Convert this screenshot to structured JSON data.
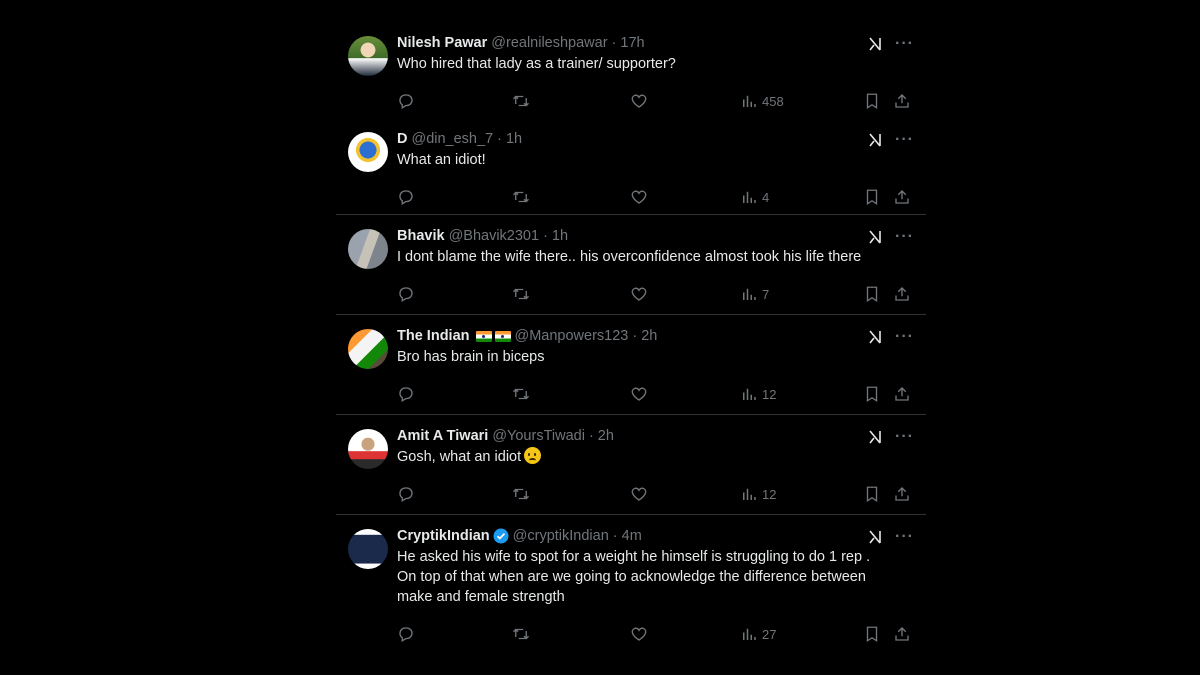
{
  "colors": {
    "background": "#000000",
    "text": "#e7e9ea",
    "muted": "#71767b",
    "divider": "#2f3336",
    "verified": "#1d9bf0"
  },
  "icons": {
    "reply": "reply-icon",
    "retweet": "retweet-icon",
    "like": "like-icon",
    "views": "views-icon",
    "bookmark": "bookmark-icon",
    "share": "share-icon",
    "grok": "grok-icon",
    "more": "more-icon"
  },
  "tweets": [
    {
      "name": "Nilesh Pawar",
      "handle": "@realnileshpawar",
      "time": "17h",
      "text": [
        "Who hired that lady as a trainer/ supporter?"
      ],
      "views": "458"
    },
    {
      "name": "D",
      "handle": "@din_esh_7",
      "time": "1h",
      "text": [
        "What an idiot!"
      ],
      "views": "4"
    },
    {
      "name": "Bhavik",
      "handle": "@Bhavik2301",
      "time": "1h",
      "text": [
        "I dont blame the wife there.. his overconfidence almost took his life there"
      ],
      "views": "7"
    },
    {
      "name": "The Indian",
      "handle": "@Manpowers123",
      "time": "2h",
      "text": [
        "Bro has brain in biceps"
      ],
      "views": "12"
    },
    {
      "name": "Amit A Tiwari",
      "handle": "@YoursTiwadi",
      "time": "2h",
      "text": [
        "Gosh, what an idiot"
      ],
      "views": "12"
    },
    {
      "name": "CryptikIndian",
      "handle": "@cryptikIndian",
      "time": "4m",
      "text": [
        "He asked his wife to spot for a weight he himself is struggling to do 1 rep .",
        "On top of that when are we going to acknowledge the difference between",
        "make and female strength"
      ],
      "views": "27"
    }
  ],
  "separator": "·"
}
